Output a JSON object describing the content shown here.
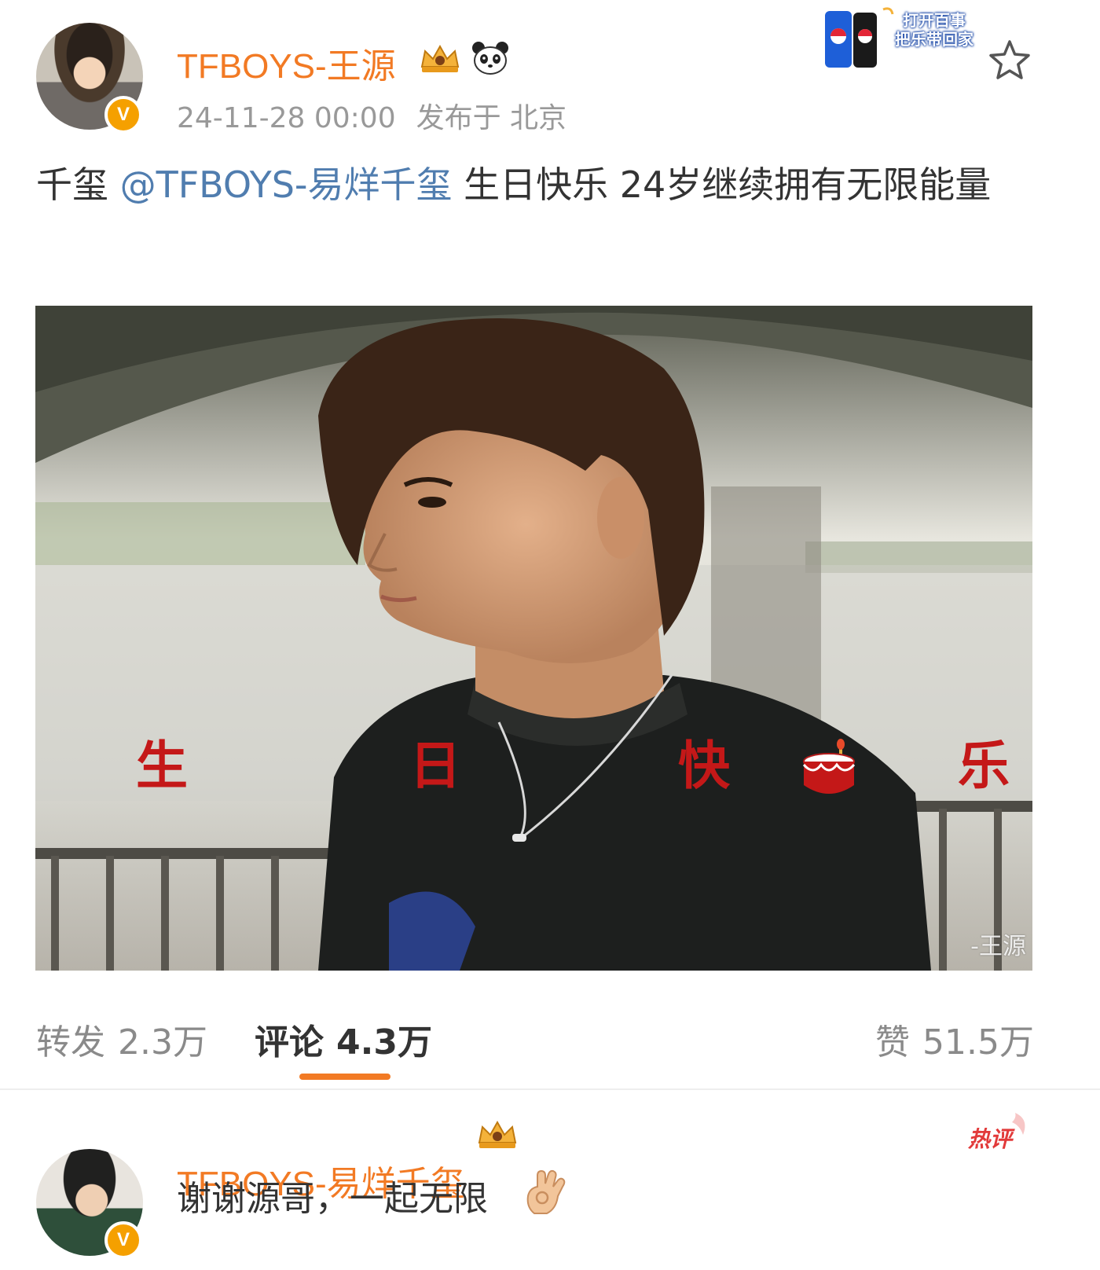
{
  "post": {
    "author": "TFBOYS-王源",
    "timestamp": "24-11-28 00:00",
    "location": "发布于 北京",
    "text_before": "千玺 ",
    "mention": "@TFBOYS-易烊千玺",
    "text_after": " 生日快乐 24岁继续拥有无限能量",
    "promo": [
      "打开百事",
      "把乐带回家"
    ]
  },
  "photo": {
    "overlay_chars": [
      "生",
      "日",
      "快",
      "乐"
    ],
    "watermark": "-王源"
  },
  "actions": {
    "repost_label": "转发",
    "repost_count": "2.3万",
    "comment_label": "评论",
    "comment_count": "4.3万",
    "like_label": "赞",
    "like_count": "51.5万"
  },
  "comment": {
    "author": "TFBOYS-易烊千玺",
    "badge": "热评",
    "text": "谢谢源哥，一起无限"
  },
  "colors": {
    "username": "#f27a24",
    "mention": "#507daf",
    "verified": "#f5a000",
    "overlay_text": "#c41818",
    "tab_indicator": "#f27a24"
  },
  "icons": [
    "crown-icon",
    "panda-icon",
    "star-icon",
    "verified-badge-icon",
    "cake-icon",
    "ok-hand-icon",
    "pepsi-can-icon"
  ]
}
